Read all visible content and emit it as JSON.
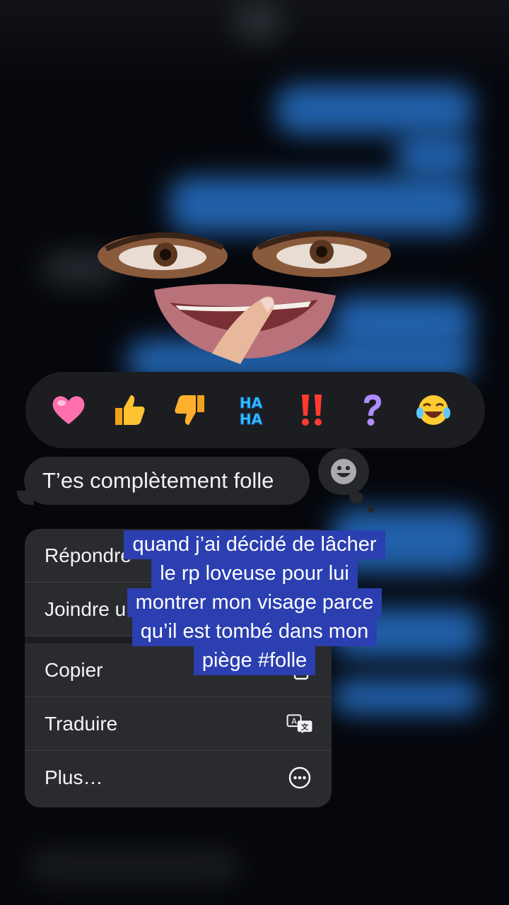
{
  "reactions": [
    {
      "name": "heart-reaction",
      "glyph": "♥"
    },
    {
      "name": "thumbs-up-reaction",
      "glyph": "👍"
    },
    {
      "name": "thumbs-down-reaction",
      "glyph": "👎"
    },
    {
      "name": "haha-reaction",
      "glyph": "HA HA"
    },
    {
      "name": "exclamation-reaction",
      "glyph": "‼"
    },
    {
      "name": "question-reaction",
      "glyph": "?"
    },
    {
      "name": "laugh-cry-reaction",
      "glyph": "😂"
    }
  ],
  "message": {
    "text": "T’es complètement folle"
  },
  "menu": {
    "reply_label": "Répondre",
    "attach_label": "Joindre un autocollant",
    "copy_label": "Copier",
    "translate_label": "Traduire",
    "more_label": "Plus…"
  },
  "caption": {
    "lines": [
      "quand j’ai décidé de lâcher",
      "le rp loveuse pour lui",
      "montrer mon visage parce",
      "qu’il est tombé dans mon",
      "piège #folle"
    ]
  },
  "colors": {
    "accent_blue": "#2b7fe0",
    "caption_bg": "#2b3fb0",
    "menu_bg": "#2a2b2f"
  }
}
